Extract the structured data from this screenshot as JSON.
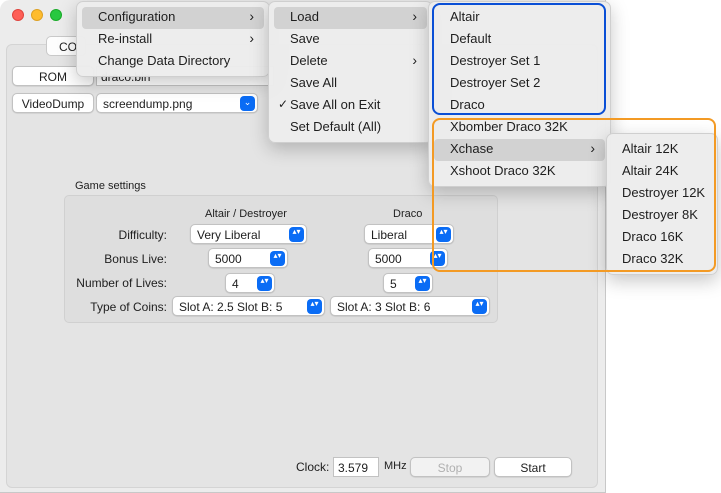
{
  "tab": {
    "label": "CO"
  },
  "rom": {
    "button_label": "ROM",
    "file": "draco.bin"
  },
  "videodump": {
    "button_label": "VideoDump",
    "file": "screendump.png"
  },
  "settings": {
    "group_label": "Game settings",
    "col_altair": "Altair / Destroyer",
    "col_draco": "Draco",
    "difficulty": {
      "label": "Difficulty:",
      "altair": "Very Liberal",
      "draco": "Liberal"
    },
    "bonus": {
      "label": "Bonus Live:",
      "altair": "5000",
      "draco": "5000"
    },
    "lives": {
      "label": "Number of Lives:",
      "altair": "4",
      "draco": "5"
    },
    "coins": {
      "label": "Type of Coins:",
      "altair": "Slot A: 2.5  Slot B: 5",
      "draco": "Slot A: 3  Slot B: 6"
    }
  },
  "bottom": {
    "clock_label": "Clock:",
    "clock_value": "3.579",
    "clock_unit": "MHz",
    "stop_label": "Stop",
    "start_label": "Start"
  },
  "menu1": [
    "Configuration",
    "Re-install",
    "Change Data Directory"
  ],
  "menu2": [
    "Load",
    "Save",
    "Delete",
    "Save All",
    "Save All on Exit",
    "Set Default (All)"
  ],
  "menu3": [
    "Altair",
    "Default",
    "Destroyer Set 1",
    "Destroyer Set 2",
    "Draco",
    "Xbomber Draco 32K",
    "Xchase",
    "Xshoot Draco 32K"
  ],
  "menu4": [
    "Altair 12K",
    "Altair 24K",
    "Destroyer 12K",
    "Destroyer 8K",
    "Draco 16K",
    "Draco 32K"
  ],
  "glyphs": {
    "chevron": "›",
    "check": "✓",
    "stepper": "▴▾"
  },
  "colors": {
    "blue_highlight": "#0a4fd6",
    "orange_highlight": "#f39a24",
    "accent": "#0a6cf5"
  }
}
